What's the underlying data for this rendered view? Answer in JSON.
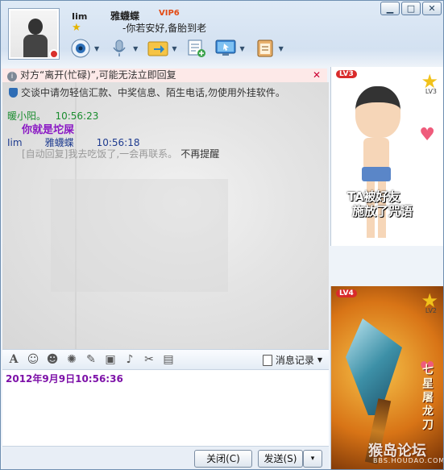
{
  "window_controls": {
    "minimize": "▁",
    "maximize": "□",
    "close": "✕"
  },
  "header": {
    "my_name": "Iim",
    "contact_nick": "雅蠛蝶",
    "vip": "VIP6",
    "signature": "-你若安好,备胎到老",
    "level_icon": "star-icon",
    "status": "busy"
  },
  "toolbar": {
    "items": [
      "video-call-icon",
      "voice-call-icon",
      "send-file-icon",
      "app-icon",
      "remote-assist-icon",
      "more-icon"
    ]
  },
  "notice": {
    "text": "对方“离开(忙碌)”,可能无法立即回复",
    "close": "✕"
  },
  "chat": {
    "tip": "交谈中请勿轻信汇款、中奖信息、陌生电话,勿使用外挂软件。",
    "messages": [
      {
        "sender": "暖小阳。",
        "time": "10:56:23",
        "body": "你就是坨屎"
      },
      {
        "sender": "Iim",
        "recipient": "雅蠛蝶",
        "time": "10:56:18",
        "body": "[自动回复]我去吃饭了,一会再联系。",
        "dnr": "不再提醒"
      }
    ]
  },
  "format_bar": {
    "icons": [
      "font-icon",
      "emoji-icon",
      "magic-emoji-icon",
      "shake-icon",
      "handwriting-icon",
      "image-icon",
      "music-icon",
      "screenshot-icon",
      "briefcase-icon"
    ],
    "history_label": "消息记录"
  },
  "input": {
    "text": "2012年9月9日10:56:36"
  },
  "buttons": {
    "close": "关闭(C)",
    "send": "发送(S)",
    "send_drop": "▾"
  },
  "right_panel": {
    "show1": {
      "level": "LV3",
      "caption_line1": "TA被好友",
      "caption_line2": "施放了咒语",
      "badge": "LV3"
    },
    "show2": {
      "level": "LV4",
      "badge": "LV2",
      "title": "七星屠龙刀",
      "watermark": "猴岛论坛",
      "watermark_sub": "BBS.HOUDAO.COM"
    }
  },
  "colors": {
    "notice_bg": "#fde9e8",
    "msg1_sender": "#1a8c2e",
    "msg1_body": "#8a17c4",
    "msg2_sender": "#1e3b8f",
    "input_text": "#7d11a8"
  }
}
